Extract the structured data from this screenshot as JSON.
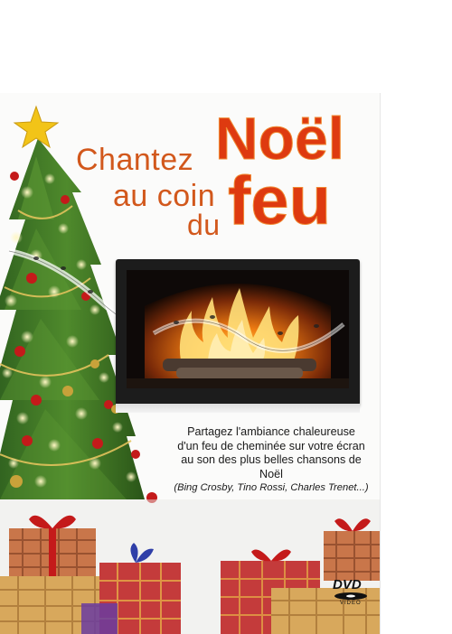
{
  "title": {
    "line1": "Chantez",
    "line2": "au coin",
    "line3": "du",
    "big1": "Noël",
    "big2": "feu"
  },
  "blurb": {
    "line1": "Partagez l'ambiance chaleureuse",
    "line2": "d'un feu de cheminée sur votre écran",
    "line3": "au son des plus belles chansons de Noël",
    "line4": "(Bing Crosby, Tino Rossi, Charles Trenet...)"
  },
  "logo": {
    "dvd": "DVD",
    "video": "VIDEO"
  },
  "colors": {
    "title_orange": "#d2581c",
    "title_red": "#de3a10",
    "tree_green": "#2f6b22",
    "fire_orange": "#f07d12"
  }
}
